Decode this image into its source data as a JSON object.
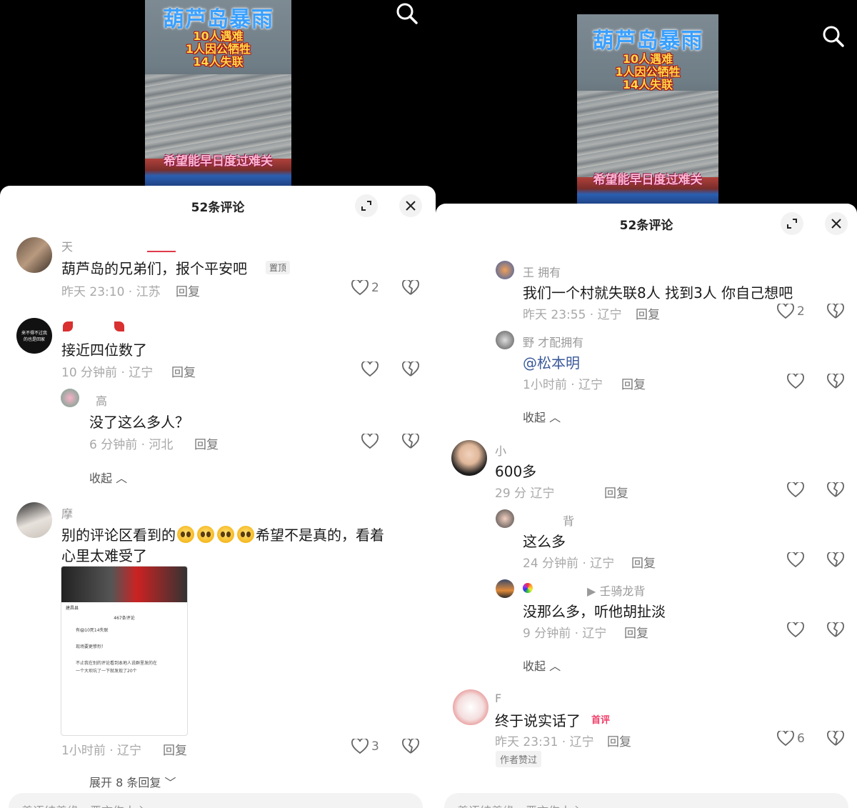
{
  "common": {
    "comment_count_title": "52条评论",
    "reply_label": "回复",
    "collapse_label": "收起",
    "video": {
      "title": "葫芦岛暴雨",
      "lines": [
        "10人遇难",
        "1人因公牺牲",
        "14人失联"
      ],
      "caption": "希望能早日度过难关"
    }
  },
  "left": {
    "comments": [
      {
        "name": "天",
        "text": "葫芦岛的兄弟们，报个平安吧",
        "badge": "置顶",
        "meta": "昨天 23:10 · 江苏",
        "likes": "2"
      },
      {
        "avatar_text": "来不得不过我的也是回家",
        "text": "接近四位数了",
        "meta": "10 分钟前 · 辽宁"
      },
      {
        "name": "高",
        "text": "没了这么多人？",
        "meta": "6 分钟前 · 河北"
      },
      {
        "name": "摩",
        "text_pre": "别的评论区看到的",
        "text_post": "希望不是真的，看着",
        "text_line2": "心里太难受了",
        "meta": "1小时前 · 辽宁",
        "likes": "3"
      }
    ],
    "screenshot": {
      "header": "467条评论",
      "location": "建昌县",
      "rows": [
        "有😱10死14失联",
        "现场要更惨烈！",
        "不止我在别的评论看到本地人说群里发的在",
        "一个大坝坑了一下就发现了20个"
      ]
    },
    "expand_label": "展开 8 条回复",
    "input_placeholder": "善语结善缘，恶言伤人心"
  },
  "right": {
    "comments": [
      {
        "name": "王 拥有",
        "text": "我们一个村就失联8人 找到3人 你自己想吧",
        "meta": "昨天 23:55 · 辽宁",
        "likes": "2"
      },
      {
        "name": "野 才配拥有",
        "text": "@松本明",
        "meta": "1小时前 · 辽宁"
      },
      {
        "name": "小",
        "text": "600多",
        "meta": "29 分   辽宁"
      },
      {
        "name": "背",
        "text": "这么多",
        "meta": "24 分钟前 · 辽宁"
      },
      {
        "name": "▶ 壬骑龙背",
        "text": "没那么多，听他胡扯淡",
        "meta": "9 分钟前 · 辽宁"
      },
      {
        "name": "F",
        "text": "终于说实话了",
        "badge": "首评",
        "meta": "昨天 23:31 · 辽宁",
        "likes": "6",
        "author_liked": "作者赞过"
      }
    ],
    "input_placeholder": "善语结善缘，恶言伤人心"
  }
}
